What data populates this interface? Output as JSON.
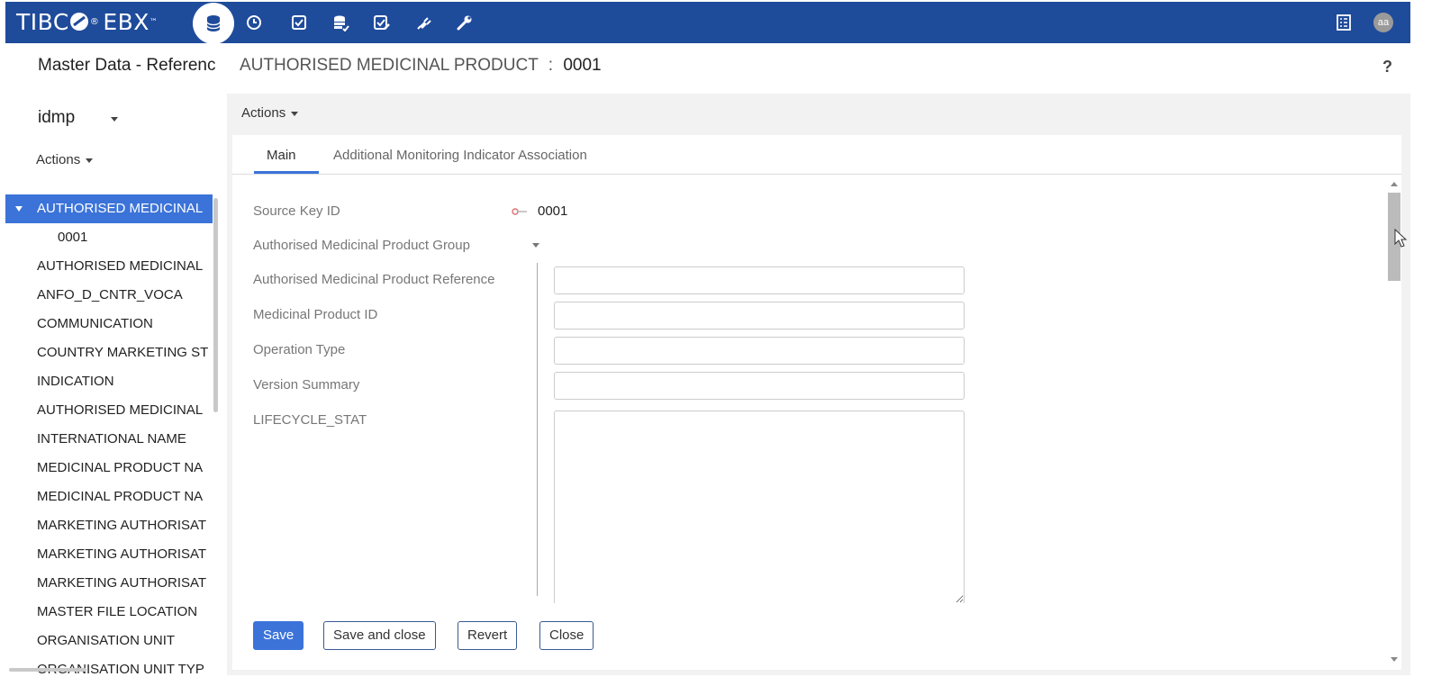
{
  "topbar": {
    "logo_text": "TIBC",
    "logo_text2": "EBX",
    "logo_tm": "™",
    "nav_icons": [
      "database-icon",
      "clock-icon",
      "checkbox-icon",
      "data-workflow-icon",
      "task-check-icon",
      "plug-icon",
      "wrench-icon"
    ],
    "avatar_initials": "aa",
    "bg_color": "#1f4b9b"
  },
  "header": {
    "left_title": "Master Data - Referenc",
    "record_table": "AUTHORISED MEDICINAL PRODUCT",
    "separator": ":",
    "record_id": "0001",
    "help": "?"
  },
  "sidebar": {
    "dataspace": "idmp",
    "actions_label": "Actions",
    "tree": [
      {
        "label": "AUTHORISED MEDICINAL",
        "selected": true
      },
      {
        "label": "0001",
        "child": true
      },
      {
        "label": "AUTHORISED MEDICINAL"
      },
      {
        "label": "ANFO_D_CNTR_VOCA"
      },
      {
        "label": "COMMUNICATION"
      },
      {
        "label": "COUNTRY MARKETING ST"
      },
      {
        "label": "INDICATION"
      },
      {
        "label": "AUTHORISED MEDICINAL"
      },
      {
        "label": "INTERNATIONAL NAME"
      },
      {
        "label": "MEDICINAL PRODUCT NA"
      },
      {
        "label": "MEDICINAL PRODUCT NA"
      },
      {
        "label": "MARKETING AUTHORISAT"
      },
      {
        "label": "MARKETING AUTHORISAT"
      },
      {
        "label": "MARKETING AUTHORISAT"
      },
      {
        "label": "MASTER FILE LOCATION"
      },
      {
        "label": "ORGANISATION UNIT"
      },
      {
        "label": "ORGANISATION UNIT TYP"
      }
    ],
    "selected_color": "#3b73d9"
  },
  "main": {
    "actions_label": "Actions",
    "tabs": [
      {
        "label": "Main",
        "active": true
      },
      {
        "label": "Additional Monitoring Indicator Association",
        "active": false
      }
    ],
    "form": {
      "source_key_label": "Source Key ID",
      "source_key_value": "0001",
      "group_label": "Authorised Medicinal Product Group",
      "fields": [
        {
          "label": "Authorised Medicinal Product Reference",
          "value": ""
        },
        {
          "label": "Medicinal Product ID",
          "value": ""
        },
        {
          "label": "Operation Type",
          "value": ""
        },
        {
          "label": "Version Summary",
          "value": ""
        }
      ],
      "lifecycle_label": "LIFECYCLE_STAT",
      "lifecycle_value": ""
    },
    "buttons": {
      "save": "Save",
      "save_close": "Save and close",
      "revert": "Revert",
      "close": "Close"
    },
    "accent_color": "#3b73d9"
  }
}
